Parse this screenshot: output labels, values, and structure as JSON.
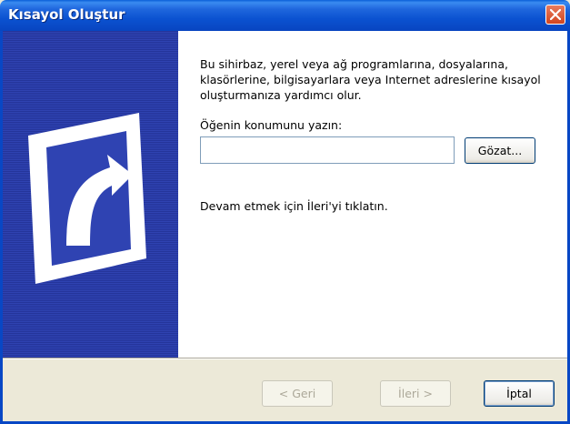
{
  "window": {
    "title": "Kısayol Oluştur"
  },
  "content": {
    "description": "Bu sihirbaz, yerel veya ağ programlarına, dosyalarına, klasörlerine, bilgisayarlara veya Internet adreslerine kısayol oluşturmanıza yardımcı olur.",
    "location_label": "Öğenin konumunu yazın:",
    "location_value": "",
    "browse_label": "Gözat...",
    "hint": "Devam etmek için İleri'yi tıklatın."
  },
  "buttons": {
    "back": "< Geri",
    "next": "İleri >",
    "cancel": "İptal"
  },
  "colors": {
    "titlebar": "#0b52d1",
    "banner": "#2f43b2",
    "close": "#d2451e",
    "face": "#ece9d8"
  },
  "icons": {
    "close": "close-icon",
    "banner": "shortcut-arrow-icon"
  }
}
